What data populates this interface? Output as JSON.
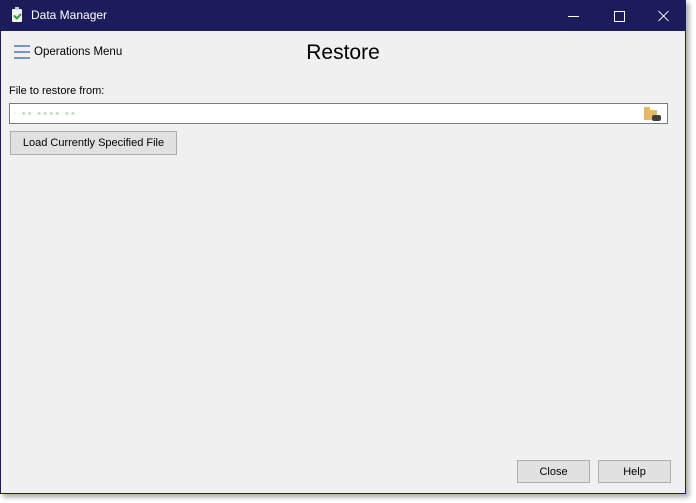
{
  "window": {
    "title": "Data Manager",
    "app_icon": "clipboard-check-icon",
    "controls": {
      "minimize": "minimize-icon",
      "maximize": "maximize-icon",
      "close": "close-icon"
    }
  },
  "header": {
    "menu_label": "Operations Menu",
    "menu_icon": "hamburger-icon",
    "page_title": "Restore"
  },
  "form": {
    "file_label": "File to restore from:",
    "file_value": "· ∙∙ ∙∙∙∙  ∙∙",
    "browse_icon": "folder-binoculars-icon",
    "load_button": "Load Currently Specified File"
  },
  "footer": {
    "close_button": "Close",
    "help_button": "Help"
  },
  "colors": {
    "titlebar": "#1c1c5c",
    "background": "#f0f0f0",
    "button": "#e1e1e1"
  }
}
